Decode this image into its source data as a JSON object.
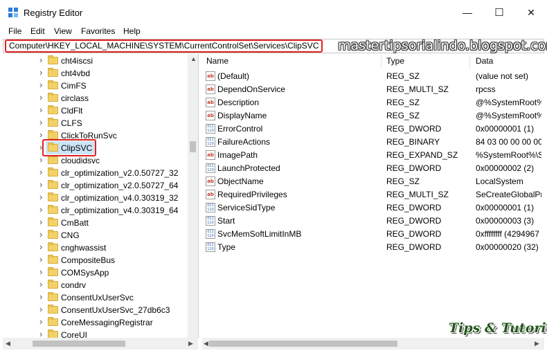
{
  "window": {
    "title": "Registry Editor",
    "controls": {
      "minimize": "—",
      "maximize": "☐",
      "close": "✕"
    }
  },
  "menu": [
    "File",
    "Edit",
    "View",
    "Favorites",
    "Help"
  ],
  "address": "Computer\\HKEY_LOCAL_MACHINE\\SYSTEM\\CurrentControlSet\\Services\\ClipSVC",
  "watermark": "mastertipsorialindo.blogspot.com",
  "tree": {
    "selected": "ClipSVC",
    "items": [
      "cht4iscsi",
      "cht4vbd",
      "CimFS",
      "circlass",
      "CldFlt",
      "CLFS",
      "ClickToRunSvc",
      "ClipSVC",
      "cloudidsvc",
      "clr_optimization_v2.0.50727_32",
      "clr_optimization_v2.0.50727_64",
      "clr_optimization_v4.0.30319_32",
      "clr_optimization_v4.0.30319_64",
      "CmBatt",
      "CNG",
      "cnghwassist",
      "CompositeBus",
      "COMSysApp",
      "condrv",
      "ConsentUxUserSvc",
      "ConsentUxUserSvc_27db6c3",
      "CoreMessagingRegistrar",
      "CoreUI"
    ]
  },
  "columns": {
    "name": "Name",
    "type": "Type",
    "data": "Data"
  },
  "values": [
    {
      "icon": "ab",
      "name": "(Default)",
      "type": "REG_SZ",
      "data": "(value not set)"
    },
    {
      "icon": "ab",
      "name": "DependOnService",
      "type": "REG_MULTI_SZ",
      "data": "rpcss"
    },
    {
      "icon": "ab",
      "name": "Description",
      "type": "REG_SZ",
      "data": "@%SystemRoot%\\"
    },
    {
      "icon": "ab",
      "name": "DisplayName",
      "type": "REG_SZ",
      "data": "@%SystemRoot%\\"
    },
    {
      "icon": "bin",
      "name": "ErrorControl",
      "type": "REG_DWORD",
      "data": "0x00000001 (1)"
    },
    {
      "icon": "bin",
      "name": "FailureActions",
      "type": "REG_BINARY",
      "data": "84 03 00 00 00 00 0"
    },
    {
      "icon": "ab",
      "name": "ImagePath",
      "type": "REG_EXPAND_SZ",
      "data": "%SystemRoot%\\Sy"
    },
    {
      "icon": "bin",
      "name": "LaunchProtected",
      "type": "REG_DWORD",
      "data": "0x00000002 (2)"
    },
    {
      "icon": "ab",
      "name": "ObjectName",
      "type": "REG_SZ",
      "data": "LocalSystem"
    },
    {
      "icon": "ab",
      "name": "RequiredPrivileges",
      "type": "REG_MULTI_SZ",
      "data": "SeCreateGlobalPriv"
    },
    {
      "icon": "bin",
      "name": "ServiceSidType",
      "type": "REG_DWORD",
      "data": "0x00000001 (1)"
    },
    {
      "icon": "bin",
      "name": "Start",
      "type": "REG_DWORD",
      "data": "0x00000003 (3)"
    },
    {
      "icon": "bin",
      "name": "SvcMemSoftLimitInMB",
      "type": "REG_DWORD",
      "data": "0xffffffff (4294967"
    },
    {
      "icon": "bin",
      "name": "Type",
      "type": "REG_DWORD",
      "data": "0x00000020 (32)"
    }
  ],
  "logo_text": "Tips & Tutorial"
}
